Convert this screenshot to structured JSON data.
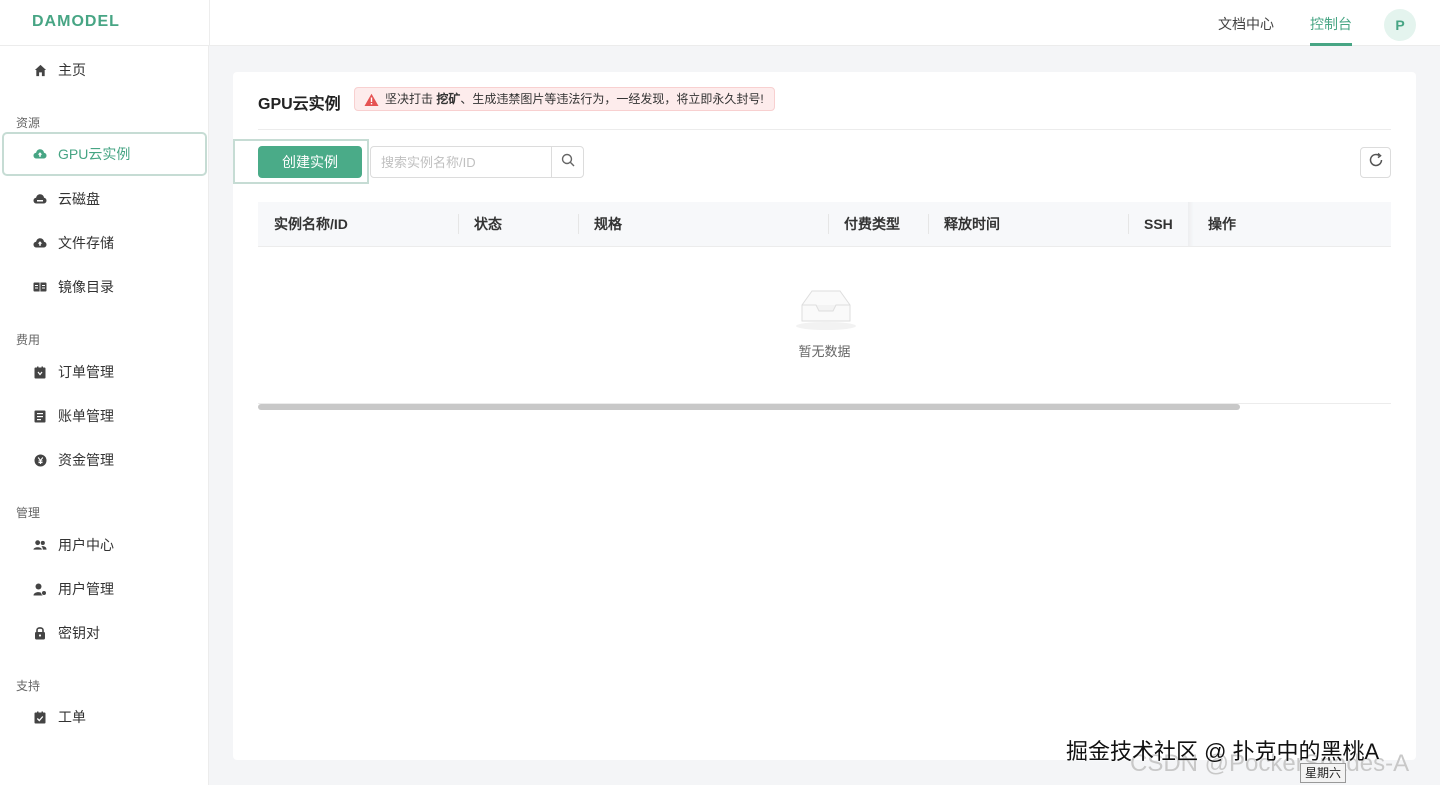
{
  "header": {
    "logo": "DAMODEL",
    "nav": {
      "docs": "文档中心",
      "console": "控制台"
    },
    "avatar_letter": "P"
  },
  "sidebar": {
    "home": "主页",
    "groups": {
      "resources": "资源",
      "billing": "费用",
      "management": "管理",
      "support": "支持"
    },
    "items": {
      "gpu": "GPU云实例",
      "disk": "云磁盘",
      "files": "文件存储",
      "images": "镜像目录",
      "orders": "订单管理",
      "bills": "账单管理",
      "funds": "资金管理",
      "user_center": "用户中心",
      "user_manage": "用户管理",
      "keypair": "密钥对",
      "ticket": "工单"
    }
  },
  "main": {
    "title": "GPU云实例",
    "warning_pre": "坚决打击 ",
    "warning_bold": "挖矿",
    "warning_post": "、生成违禁图片等违法行为，一经发现，将立即永久封号!",
    "create_label": "创建实例",
    "search_placeholder": "搜索实例名称/ID",
    "columns": [
      "实例名称/ID",
      "状态",
      "规格",
      "付费类型",
      "释放时间",
      "SSH",
      "操作"
    ],
    "empty_text": "暂无数据"
  },
  "watermark": {
    "cn": "掘金技术社区 @ 扑克中的黑桃A",
    "csdn": "CSDN @PockerSpades-A",
    "day": "星期六"
  },
  "colors": {
    "accent": "#47a584",
    "button": "#4aab88",
    "warn_bg": "#fdecec",
    "warn_icon": "#e55353"
  }
}
